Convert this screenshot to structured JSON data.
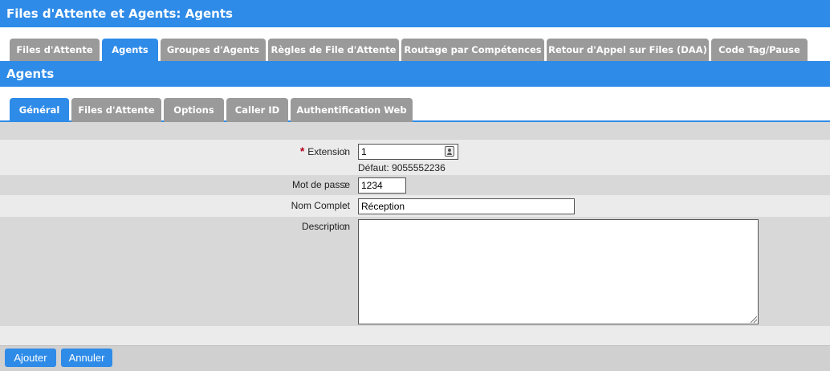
{
  "header": {
    "title": "Files d'Attente et Agents:  Agents"
  },
  "main_tabs": [
    {
      "label": "Files d'Attente"
    },
    {
      "label": "Agents"
    },
    {
      "label": "Groupes d'Agents"
    },
    {
      "label": "Règles de File d'Attente"
    },
    {
      "label": "Routage par Compétences"
    },
    {
      "label": "Retour d'Appel sur Files (DAA)"
    },
    {
      "label": "Code Tag/Pause"
    }
  ],
  "active_main_tab": "Agents",
  "section": {
    "title": "Agents"
  },
  "sub_tabs": [
    {
      "label": "Général"
    },
    {
      "label": "Files d'Attente"
    },
    {
      "label": "Options"
    },
    {
      "label": "Caller ID"
    },
    {
      "label": "Authentification Web"
    }
  ],
  "active_sub_tab": "Général",
  "form": {
    "extension": {
      "required_mark": "*",
      "label": "Extension",
      "colon": ":",
      "value": "1",
      "hint": "Défaut: 9055552236"
    },
    "password": {
      "label": "Mot de passe",
      "colon": ":",
      "value": "1234"
    },
    "full_name": {
      "label": "Nom Complet",
      "colon": ":",
      "value": "Réception"
    },
    "description": {
      "label": "Description",
      "colon": ":",
      "value": ""
    }
  },
  "buttons": {
    "add": "Ajouter",
    "cancel": "Annuler"
  },
  "colors": {
    "accent": "#2e8be8",
    "tab_inactive": "#9a9a9a",
    "required": "#b2001a"
  }
}
